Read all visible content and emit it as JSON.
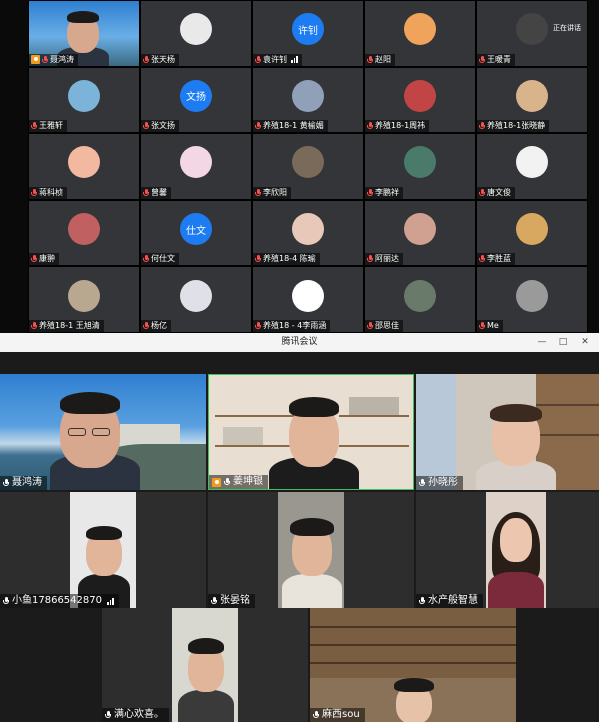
{
  "top_gallery": {
    "rows": [
      [
        {
          "name": "聂鸿涛",
          "type": "photo",
          "host": true
        },
        {
          "name": "张天杨",
          "type": "avatar",
          "color": "#e9e9e9"
        },
        {
          "name": "袁许钊",
          "type": "text",
          "label": "许钊",
          "color": "#1e7cf2",
          "signal": true
        },
        {
          "name": "赵阳",
          "type": "avatar",
          "color": "#f0a35a"
        },
        {
          "name": "王暖青",
          "type": "avatar",
          "color": "#444",
          "status": "正在讲话"
        }
      ],
      [
        {
          "name": "王雅轩",
          "type": "avatar",
          "color": "#7bb3d9"
        },
        {
          "name": "张文扬",
          "type": "text",
          "label": "文扬",
          "color": "#1e7cf2"
        },
        {
          "name": "养殖18-1 黄榆媚",
          "type": "avatar",
          "color": "#8fa0b8"
        },
        {
          "name": "养殖18-1周祎",
          "type": "avatar",
          "color": "#c24545"
        },
        {
          "name": "养殖18-1张晓静",
          "type": "avatar",
          "color": "#d9b38c"
        }
      ],
      [
        {
          "name": "蒋科桢",
          "type": "avatar",
          "color": "#f2b8a0"
        },
        {
          "name": "曾馨",
          "type": "avatar",
          "color": "#f4d7e4"
        },
        {
          "name": "李欣阳",
          "type": "avatar",
          "color": "#7a6a5a"
        },
        {
          "name": "李鹏祥",
          "type": "avatar",
          "color": "#4a7a6a"
        },
        {
          "name": "唐文俊",
          "type": "avatar",
          "color": "#f2f2f2"
        }
      ],
      [
        {
          "name": "康翀",
          "type": "avatar",
          "color": "#c06060"
        },
        {
          "name": "何仕文",
          "type": "text",
          "label": "仕文",
          "color": "#1e7cf2"
        },
        {
          "name": "养殖18-4 陈瑜",
          "type": "avatar",
          "color": "#e8c8b8"
        },
        {
          "name": "阿丽达",
          "type": "avatar",
          "color": "#d0a090"
        },
        {
          "name": "李胜蓝",
          "type": "avatar",
          "color": "#d9a860"
        }
      ],
      [
        {
          "name": "养殖18-1  王旭清",
          "type": "avatar",
          "color": "#b8a890"
        },
        {
          "name": "杨亿",
          "type": "avatar",
          "color": "#e0e0e8"
        },
        {
          "name": "养殖18 - 4李雨涵",
          "type": "avatar",
          "color": "#ffffff"
        },
        {
          "name": "邵思佳",
          "type": "avatar",
          "color": "#6a7a6a"
        },
        {
          "name": "Me",
          "type": "avatar",
          "color": "#9a9a9a"
        }
      ]
    ]
  },
  "window": {
    "title": "腾讯会议",
    "minimize": "—",
    "maximize": "□",
    "close": "✕"
  },
  "video_grid": {
    "tiles": [
      {
        "name": "聂鸿涛"
      },
      {
        "name": "姜坤银",
        "host": true
      },
      {
        "name": "孙晓彤"
      },
      {
        "name": "小鱼17866542870",
        "signal": true
      },
      {
        "name": "张晏铭"
      },
      {
        "name": "水产般智慧"
      },
      {
        "name": "满心欢喜。"
      },
      {
        "name": "麻西sou"
      }
    ]
  }
}
